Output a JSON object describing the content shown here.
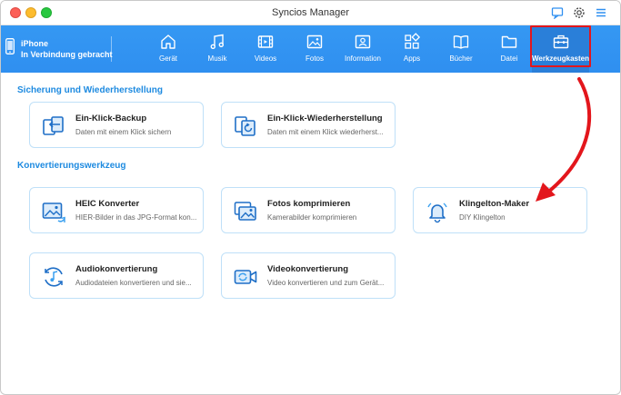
{
  "window": {
    "title": "Syncios Manager"
  },
  "colors": {
    "accent": "#2f8ff0",
    "highlight": "#e3161c",
    "section": "#1d8ae0"
  },
  "device": {
    "name": "iPhone",
    "status": "In Verbindung gebracht"
  },
  "nav": [
    {
      "label": "Gerät",
      "icon": "home-icon"
    },
    {
      "label": "Musik",
      "icon": "music-icon"
    },
    {
      "label": "Videos",
      "icon": "film-icon"
    },
    {
      "label": "Fotos",
      "icon": "image-icon"
    },
    {
      "label": "Information",
      "icon": "contact-card-icon"
    },
    {
      "label": "Apps",
      "icon": "apps-icon"
    },
    {
      "label": "Bücher",
      "icon": "book-icon"
    },
    {
      "label": "Datei",
      "icon": "folder-icon"
    },
    {
      "label": "Werkzeugkasten",
      "icon": "toolbox-icon",
      "active": true
    }
  ],
  "sections": {
    "backup": "Sicherung und Wiederherstellung",
    "convert": "Konvertierungswerkzeug"
  },
  "cards": {
    "backup": {
      "title": "Ein-Klick-Backup",
      "desc": "Daten mit einem Klick sichern"
    },
    "restore": {
      "title": "Ein-Klick-Wiederherstellung",
      "desc": "Daten mit einem Klick wiederherst..."
    },
    "heic": {
      "title": "HEIC Konverter",
      "desc": "HIER-Bilder in das JPG-Format kon..."
    },
    "photos": {
      "title": "Fotos komprimieren",
      "desc": "Kamerabilder komprimieren"
    },
    "ringtone": {
      "title": "Klingelton-Maker",
      "desc": "DIY Klingelton"
    },
    "audio": {
      "title": "Audiokonvertierung",
      "desc": "Audiodateien konvertieren und sie..."
    },
    "video": {
      "title": "Videokonvertierung",
      "desc": "Video konvertieren und zum Gerät..."
    }
  }
}
